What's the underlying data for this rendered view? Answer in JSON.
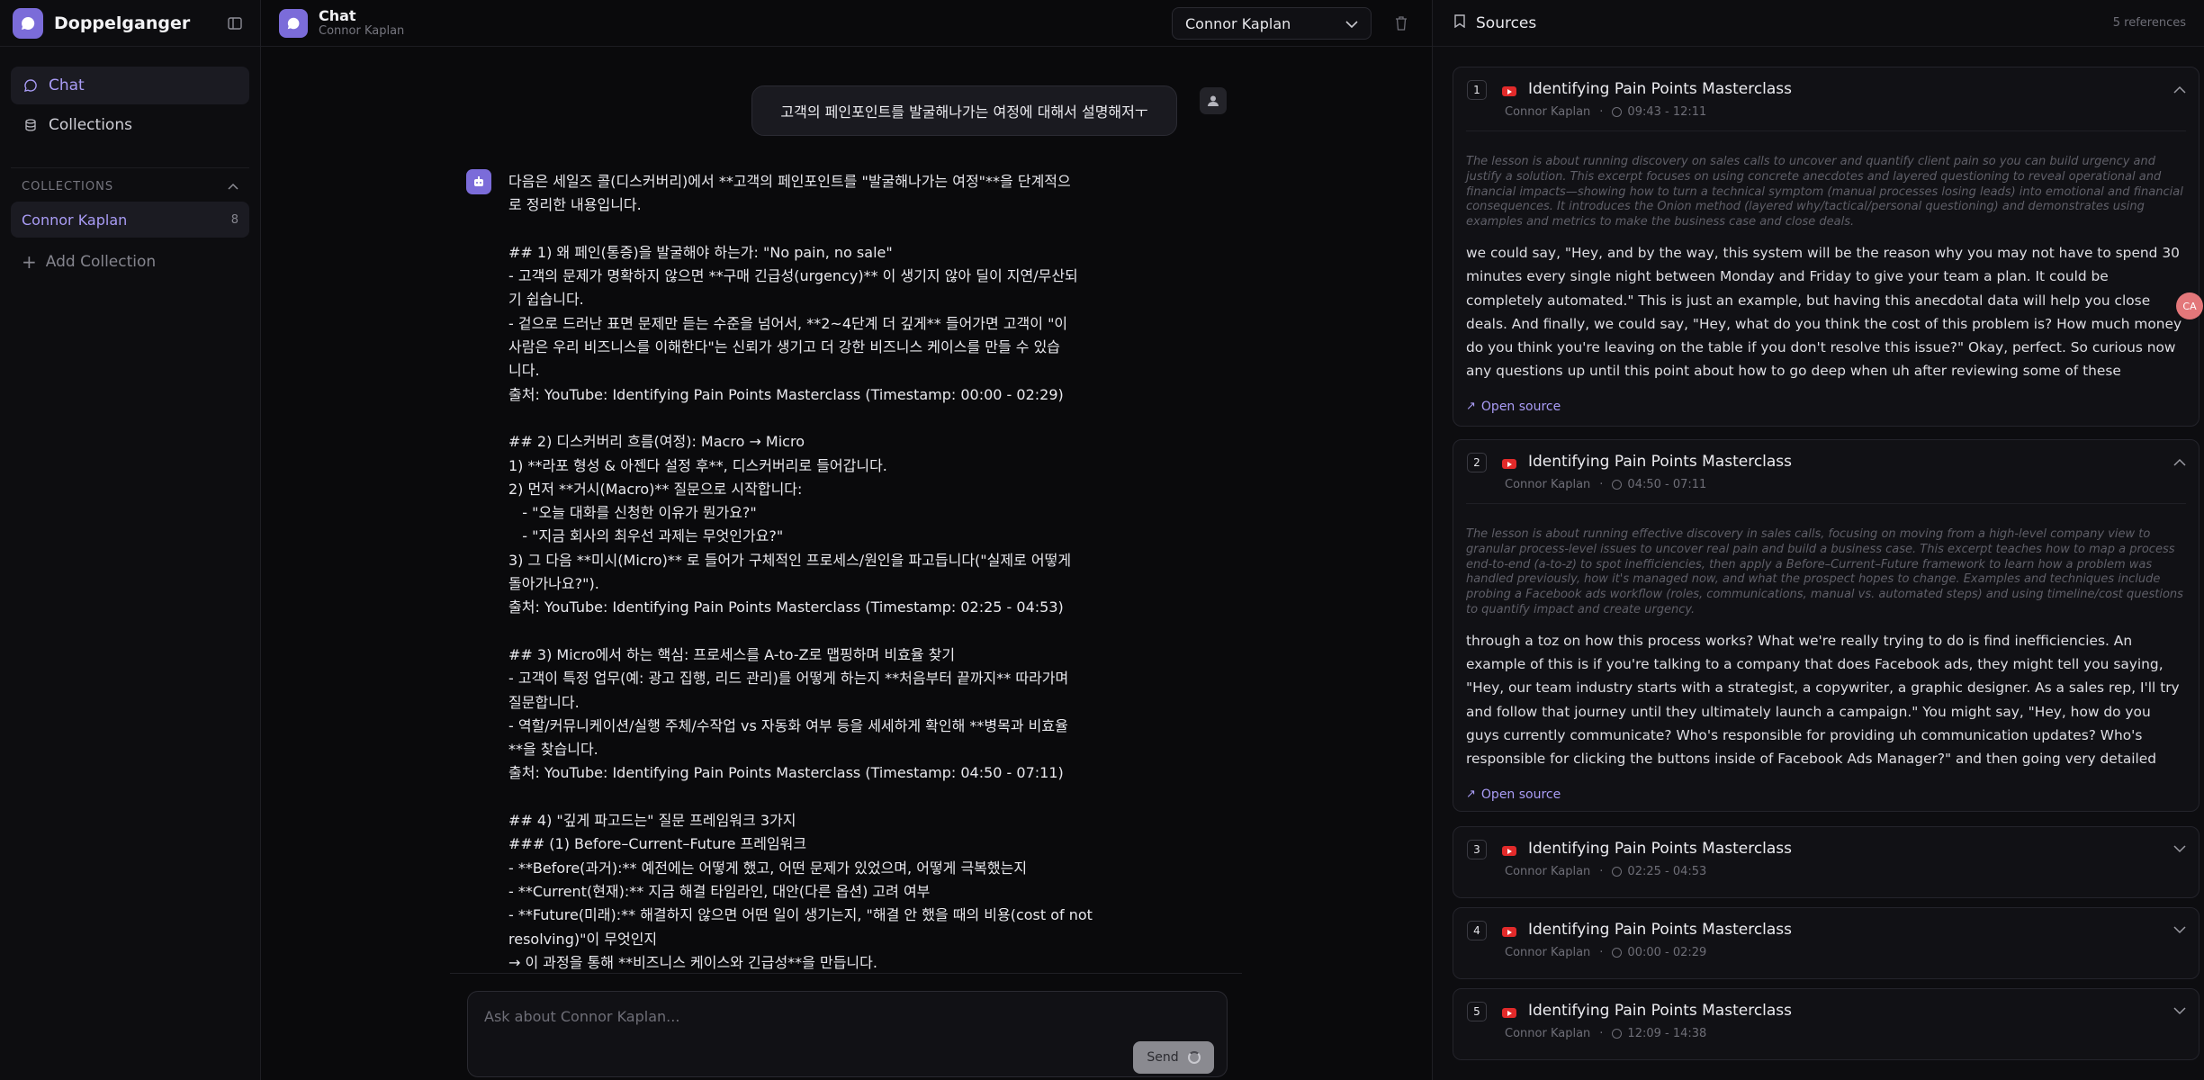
{
  "app": {
    "name": "Doppelganger"
  },
  "sidebar": {
    "nav": [
      {
        "label": "Chat"
      },
      {
        "label": "Collections"
      }
    ],
    "collections_header": "COLLECTIONS",
    "collections": [
      {
        "name": "Connor Kaplan",
        "count": "8"
      }
    ],
    "add_collection": "Add Collection"
  },
  "chat": {
    "title": "Chat",
    "subtitle": "Connor Kaplan",
    "persona": "Connor Kaplan",
    "user_message": "고객의 페인포인트를 발굴해나가는 여정에 대해서 설명해저ㅜ",
    "answer_lines": [
      "다음은 세일즈 콜(디스커버리)에서 **고객의 페인포인트를 \"발굴해나가는 여정\"**을 단계적으",
      "로 정리한 내용입니다.",
      "",
      "## 1) 왜 페인(통증)을 발굴해야 하는가: \"No pain, no sale\"",
      "- 고객의 문제가 명확하지 않으면 **구매 긴급성(urgency)** 이 생기지 않아 딜이 지연/무산되",
      "기 쉽습니다.",
      "- 겉으로 드러난 표면 문제만 듣는 수준을 넘어서, **2~4단계 더 깊게** 들어가면 고객이 \"이",
      "사람은 우리 비즈니스를 이해한다\"는 신뢰가 생기고 더 강한 비즈니스 케이스를 만들 수 있습",
      "니다.",
      "출처: YouTube: Identifying Pain Points Masterclass (Timestamp: 00:00 - 02:29)",
      "",
      "## 2) 디스커버리 흐름(여정): Macro → Micro",
      "1) **라포 형성 & 아젠다 설정 후**, 디스커버리로 들어갑니다.",
      "2) 먼저 **거시(Macro)** 질문으로 시작합니다:",
      "   - \"오늘 대화를 신청한 이유가 뭔가요?\"",
      "   - \"지금 회사의 최우선 과제는 무엇인가요?\"",
      "3) 그 다음 **미시(Micro)** 로 들어가 구체적인 프로세스/원인을 파고듭니다(\"실제로 어떻게",
      "돌아가나요?\").",
      "출처: YouTube: Identifying Pain Points Masterclass (Timestamp: 02:25 - 04:53)",
      "",
      "## 3) Micro에서 하는 핵심: 프로세스를 A-to-Z로 맵핑하며 비효율 찾기",
      "- 고객이 특정 업무(예: 광고 집행, 리드 관리)를 어떻게 하는지 **처음부터 끝까지** 따라가며",
      "질문합니다.",
      "- 역할/커뮤니케이션/실행 주체/수작업 vs 자동화 여부 등을 세세하게 확인해 **병목과 비효율",
      "**을 찾습니다.",
      "출처: YouTube: Identifying Pain Points Masterclass (Timestamp: 04:50 - 07:11)",
      "",
      "## 4) \"깊게 파고드는\" 질문 프레임워크 3가지",
      "### (1) Before–Current–Future 프레임워크",
      "- **Before(과거):** 예전에는 어떻게 했고, 어떤 문제가 있었으며, 어떻게 극복했는지",
      "- **Current(현재):** 지금 해결 타임라인, 대안(다른 옵션) 고려 여부",
      "- **Future(미래):** 해결하지 않으면 어떤 일이 생기는지, \"해결 안 했을 때의 비용(cost of not",
      "resolving)\"이 무엇인지",
      "→ 이 과정을 통해 **비즈니스 케이스와 긴급성**을 만듭니다."
    ],
    "input_placeholder": "Ask about Connor Kaplan...",
    "send_label": "Send"
  },
  "sources": {
    "title": "Sources",
    "count_label": "5 references",
    "items": [
      {
        "num": "1",
        "title": "Identifying Pain Points Masterclass",
        "author": "Connor Kaplan",
        "time": "09:43 - 12:11",
        "expanded": true,
        "summary": "The lesson is about running discovery on sales calls to uncover and quantify client pain so you can build urgency and justify a solution. This excerpt focuses on using concrete anecdotes and layered questioning to reveal operational and financial impacts—showing how to turn a technical symptom (manual processes losing leads) into emotional and financial consequences. It introduces the Onion method (layered why/tactical/personal questioning) and demonstrates using examples and metrics to make the business case and close deals.",
        "excerpt": "we could say, \"Hey, and by the way, this system will be the reason why you may not have to spend 30 minutes every single night between Monday and Friday to give your team a plan. It could be completely automated.\" This is just an example, but having this anecdotal data will help you close deals. And finally, we could say, \"Hey, what do you think the cost of this problem is? How much money do you think you're leaving on the table if you don't resolve this issue?\" Okay, perfect. So curious now any questions up until this point about how to go deep when uh after reviewing some of these questions? No. Okay, perfect. An...",
        "open_label": "Open source"
      },
      {
        "num": "2",
        "title": "Identifying Pain Points Masterclass",
        "author": "Connor Kaplan",
        "time": "04:50 - 07:11",
        "expanded": true,
        "summary": "The lesson is about running effective discovery in sales calls, focusing on moving from a high-level company view to granular process-level issues to uncover real pain and build a business case. This excerpt teaches how to map a process end-to-end (a-to-z) to spot inefficiencies, then apply a Before–Current–Future framework to learn how a problem was handled previously, how it's managed now, and what the prospect hopes to change. Examples and techniques include probing a Facebook ads workflow (roles, communications, manual vs. automated steps) and using timeline/cost questions to quantify impact and create urgency.",
        "excerpt": "through a toz on how this process works? What we're really trying to do is find inefficiencies. An example of this is if you're talking to a company that does Facebook ads, they might tell you saying, \"Hey, our team industry starts with a strategist, a copywriter, a graphic designer. As a sales rep, I'll try and follow that journey until they ultimately launch a campaign.\" You might say, \"Hey, how do you guys currently communicate? Who's responsible for providing uh communication updates? Who's responsible for clicking the buttons inside of Facebook Ads Manager?\" and then going very detailed and saying hey is this a...",
        "open_label": "Open source"
      },
      {
        "num": "3",
        "title": "Identifying Pain Points Masterclass",
        "author": "Connor Kaplan",
        "time": "02:25 - 04:53",
        "expanded": false
      },
      {
        "num": "4",
        "title": "Identifying Pain Points Masterclass",
        "author": "Connor Kaplan",
        "time": "00:00 - 02:29",
        "expanded": false
      },
      {
        "num": "5",
        "title": "Identifying Pain Points Masterclass",
        "author": "Connor Kaplan",
        "time": "12:09 - 14:38",
        "expanded": false
      }
    ]
  },
  "side_badge": "CA",
  "colors": {
    "accent": "#7b6cd9",
    "accent_text": "#a99cf5",
    "youtube": "#e22a2a",
    "background": "#0a0a0c"
  }
}
